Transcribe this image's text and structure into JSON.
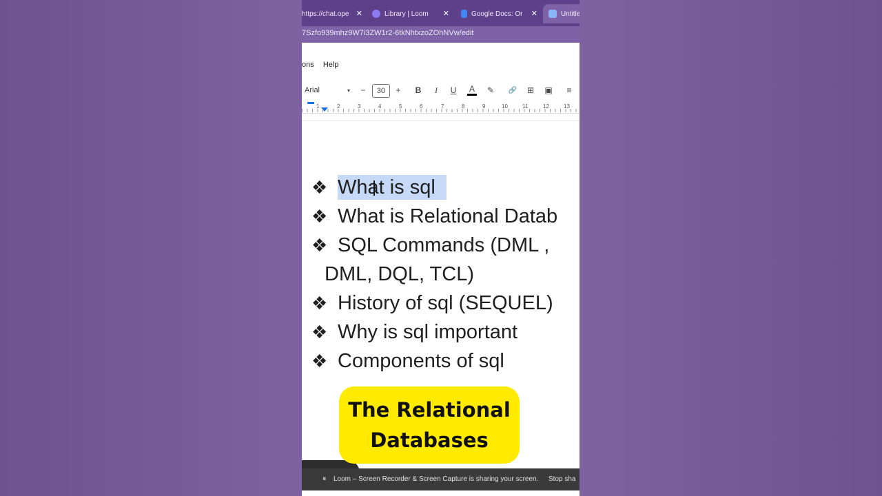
{
  "browser": {
    "tabs": [
      {
        "title": "https://chat.ope",
        "close": "✕",
        "favicon_color": "#5d3f8a"
      },
      {
        "title": "Library | Loom",
        "close": "✕",
        "favicon_color": "#8a7cf0"
      },
      {
        "title": "Google Docs: Or",
        "close": "✕",
        "favicon_color": "#4285f4"
      },
      {
        "title": "Untitle",
        "close": "",
        "favicon_color": "#8ab4f8"
      }
    ],
    "url": "7Szfo939mhz9W7i3ZW1r2-6tkNhtxzoZOhNVw/edit"
  },
  "docs": {
    "menu": [
      "ons",
      "Help"
    ],
    "toolbar": {
      "font": "Arial",
      "font_caret": "▾",
      "decrease": "−",
      "font_size": "30",
      "increase": "+",
      "bold": "B",
      "italic": "I",
      "underline": "U",
      "text_color": "A",
      "highlight": "✎",
      "link": "🔗",
      "comment": "⊞",
      "image": "▣",
      "align": "≡"
    },
    "ruler": [
      "1",
      "2",
      "3",
      "4",
      "5",
      "6",
      "7",
      "8",
      "9",
      "10",
      "11",
      "12",
      "13"
    ],
    "bullet_symbol": "❖",
    "bullets": [
      "What is sql",
      "What is Relational Datab",
      "SQL Commands (DML ,",
      "History of sql (SEQUEL)",
      "Why is sql important",
      "Components of sql"
    ],
    "wrap_line": "DML, DQL, TCL)"
  },
  "caption": {
    "line1": "The Relational",
    "line2": "Databases"
  },
  "loom": {
    "pause": "⏸",
    "message": "Loom – Screen Recorder & Screen Capture is sharing your screen.",
    "stop": "Stop sha"
  }
}
